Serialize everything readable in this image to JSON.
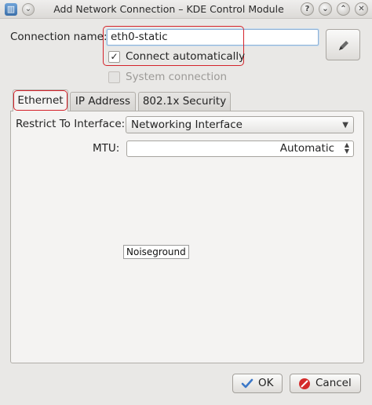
{
  "window": {
    "title": "Add Network Connection – KDE Control Module",
    "app_icon_glyph": "▥",
    "menu_glyph": "⌄",
    "help_glyph": "?",
    "minimize_glyph": "⌄",
    "maximize_glyph": "⌃",
    "close_glyph": "✕"
  },
  "connection": {
    "name_label": "Connection name:",
    "name_value": "eth0-static",
    "connect_auto_label": "Connect automatically",
    "connect_auto_checked": true,
    "system_connection_label": "System connection",
    "system_connection_checked": false
  },
  "tabs": [
    {
      "label": "Ethernet",
      "active": true
    },
    {
      "label": "IP Address",
      "active": false
    },
    {
      "label": "802.1x Security",
      "active": false
    }
  ],
  "ethernet": {
    "restrict_label": "Restrict To Interface:",
    "restrict_value": "Networking Interface",
    "mtu_label": "MTU:",
    "mtu_value": "Automatic"
  },
  "tooltip": "Noiseground",
  "buttons": {
    "ok_label": "OK",
    "cancel_label": "Cancel"
  },
  "colors": {
    "highlight_annotation": "#d4232b",
    "ok_icon": "#3c78c8",
    "cancel_icon": "#d42b2b"
  }
}
